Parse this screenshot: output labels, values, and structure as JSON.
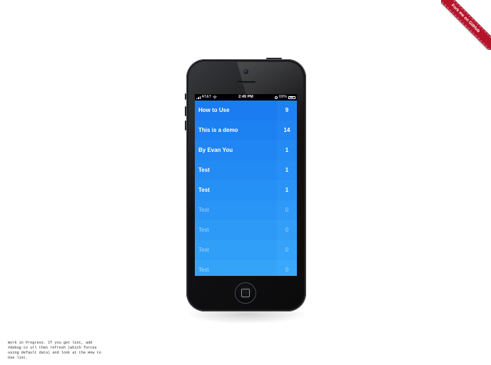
{
  "ribbon": {
    "label": "Fork me on GitHub",
    "color": "#b4142a"
  },
  "statusbar": {
    "carrier": "AT&T",
    "time": "2:49 PM",
    "battery": "69%",
    "battery_level": 0.69
  },
  "list": {
    "items": [
      {
        "title": "How to Use",
        "count": "9",
        "done": false,
        "color": "#1a7cf0",
        "count_color": "#1f80f2"
      },
      {
        "title": "This is a demo",
        "count": "14",
        "done": false,
        "color": "#1c81f1",
        "count_color": "#2185f3"
      },
      {
        "title": "By Evan You",
        "count": "1",
        "done": false,
        "color": "#1f86f3",
        "count_color": "#248af4"
      },
      {
        "title": "Test",
        "count": "1",
        "done": false,
        "color": "#228bf4",
        "count_color": "#278ff5"
      },
      {
        "title": "Test",
        "count": "1",
        "done": false,
        "color": "#2590f5",
        "count_color": "#2a94f6"
      },
      {
        "title": "Test",
        "count": "0",
        "done": true,
        "color": "#2995f6",
        "count_color": "#2e99f7"
      },
      {
        "title": "Test",
        "count": "0",
        "done": true,
        "color": "#2d9af7",
        "count_color": "#329ef8"
      },
      {
        "title": "Test",
        "count": "0",
        "done": true,
        "color": "#309ff8",
        "count_color": "#35a3f9"
      },
      {
        "title": "Test",
        "count": "0",
        "done": true,
        "color": "#34a4f9",
        "count_color": "#39a8fa"
      }
    ]
  },
  "footnote": {
    "text": "Work in Progress. If you get lost, add #debug to url then refresh (which forces using default data) and look at the How to Use list."
  }
}
